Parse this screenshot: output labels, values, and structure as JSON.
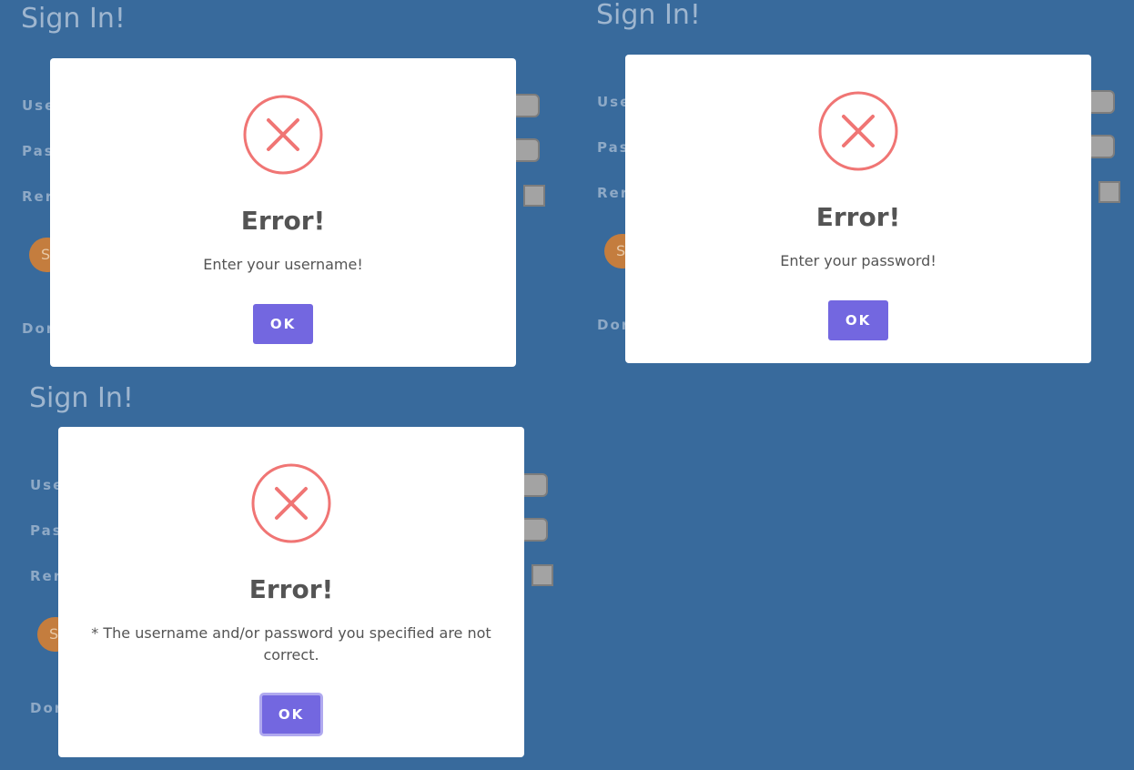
{
  "background": {
    "color": "#386a9c"
  },
  "signin_form": {
    "title": "Sign In!",
    "username_label": "Use",
    "password_label": "Pas",
    "remember_label": "Rer",
    "signin_button_label": "S",
    "footer_label": "Dor"
  },
  "dialogs": [
    {
      "title": "Error!",
      "message": "Enter your username!",
      "ok_label": "OK",
      "icon": "error-x-circle-icon"
    },
    {
      "title": "Error!",
      "message": "Enter your password!",
      "ok_label": "OK",
      "icon": "error-x-circle-icon"
    },
    {
      "title": "Error!",
      "message": "* The username and/or password you specified are not correct.",
      "ok_label": "OK",
      "icon": "error-x-circle-icon"
    }
  ],
  "colors": {
    "error_icon": "#f07574",
    "ok_button": "#7367e0",
    "signin_button": "#c47d3e",
    "input_fill": "#a3a3a3"
  }
}
